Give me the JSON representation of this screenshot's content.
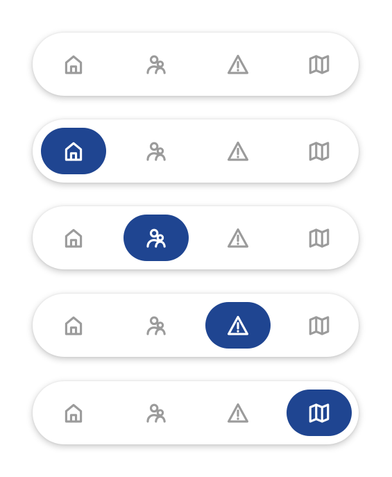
{
  "colors": {
    "accent": "#1f4591",
    "inactive_icon": "#9b9b9b",
    "active_icon": "#ffffff",
    "bar_background": "#ffffff"
  },
  "nav_items": [
    {
      "id": "home",
      "icon": "home-icon"
    },
    {
      "id": "contacts",
      "icon": "user-group-icon"
    },
    {
      "id": "alerts",
      "icon": "warning-triangle-icon"
    },
    {
      "id": "map",
      "icon": "map-icon"
    }
  ],
  "variants": [
    {
      "active_index": null
    },
    {
      "active_index": 0
    },
    {
      "active_index": 1
    },
    {
      "active_index": 2
    },
    {
      "active_index": 3
    }
  ]
}
